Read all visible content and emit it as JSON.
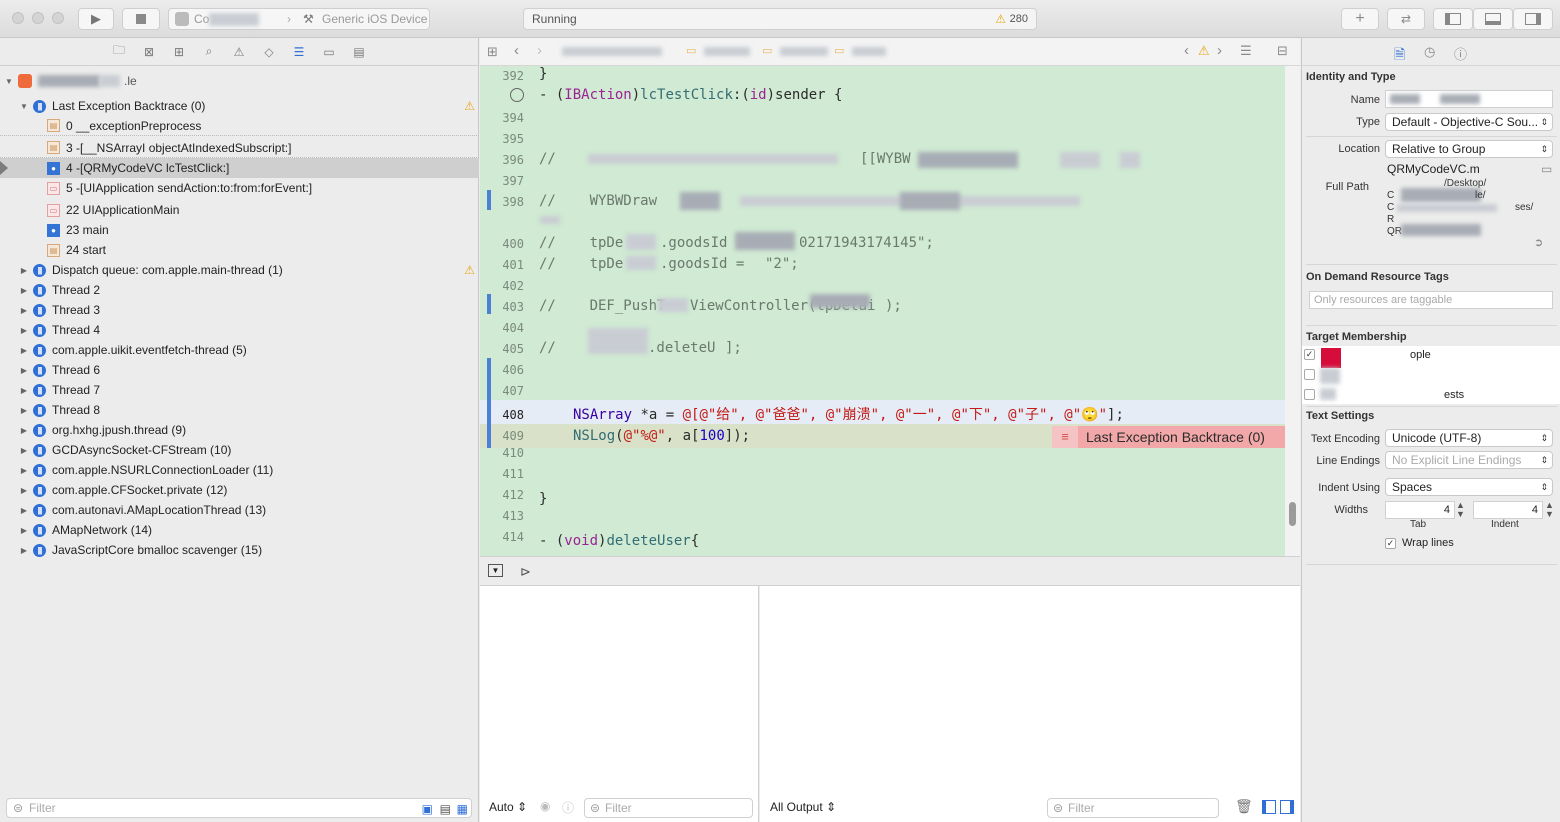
{
  "toolbar": {
    "scheme_prefix": "Co",
    "device": "Generic iOS Device",
    "status": "Running",
    "warning_count": "280"
  },
  "navigator": {
    "rows": [
      {
        "label": "Last Exception Backtrace (0)",
        "warn": true
      },
      {
        "label": "0 __exceptionPreprocess"
      },
      {
        "label": "3 -[__NSArrayI objectAtIndexedSubscript:]"
      },
      {
        "label": "4 -[QRMyCodeVC lcTestClick:]"
      },
      {
        "label": "5 -[UIApplication sendAction:to:from:forEvent:]"
      },
      {
        "label": "22 UIApplicationMain"
      },
      {
        "label": "23 main"
      },
      {
        "label": "24 start"
      },
      {
        "label": "Dispatch queue: com.apple.main-thread (1)",
        "warn": true
      },
      {
        "label": "Thread 2"
      },
      {
        "label": "Thread 3"
      },
      {
        "label": "Thread 4"
      },
      {
        "label": "com.apple.uikit.eventfetch-thread (5)"
      },
      {
        "label": "Thread 6"
      },
      {
        "label": "Thread 7"
      },
      {
        "label": "Thread 8"
      },
      {
        "label": "org.hxhg.jpush.thread (9)"
      },
      {
        "label": "GCDAsyncSocket-CFStream (10)"
      },
      {
        "label": "com.apple.NSURLConnectionLoader (11)"
      },
      {
        "label": "com.apple.CFSocket.private (12)"
      },
      {
        "label": "com.autonavi.AMapLocationThread (13)"
      },
      {
        "label": "AMapNetwork (14)"
      },
      {
        "label": "JavaScriptCore bmalloc scavenger (15)"
      }
    ],
    "project_suffix": ".le",
    "filter_placeholder": "Filter"
  },
  "editor": {
    "line_numbers": [
      "392",
      "",
      "394",
      "395",
      "396",
      "397",
      "398",
      "",
      "400",
      "401",
      "402",
      "403",
      "404",
      "405",
      "406",
      "407",
      "408",
      "409",
      "410",
      "411",
      "412",
      "413",
      "414"
    ],
    "code": {
      "l392": "}",
      "l393_a": "- (",
      "l393_b": "IBAction",
      "l393_c": ")",
      "l393_d": "lcTestClick",
      "l393_e": ":(",
      "l393_f": "id",
      "l393_g": ")sender {",
      "l396": "//    ",
      "l396_tail": "[[WYBW",
      "l398": "//    WYBWDraw",
      "l400": "//    ",
      "l400_a": "tpDe",
      "l400_b": ".goodsId",
      "l400_c": "02171943174145\";",
      "l401": "//    ",
      "l401_a": "tpDe",
      "l401_b": ".goodsId = ",
      "l401_c": "\"2\";",
      "l403": "//    DEF_PushT",
      "l403_b": "ViewController(tpDetai",
      "l403_c": ");",
      "l405": "//    ",
      "l405_b": ".deleteU",
      "l405_c": "];",
      "l408_a": "NSArray",
      "l408_b": " *a = ",
      "l408_c": "@[@\"给\", @\"爸爸\", @\"崩溃\", @\"一\", @\"下\", @\"子\", @\"",
      "l408_d": "🙄",
      "l408_e": "\"",
      "l408_f": "];",
      "l409_a": "NSLog",
      "l409_b": "(",
      "l409_c": "@\"%@\"",
      "l409_d": ", a[",
      "l409_e": "100",
      "l409_f": "]);",
      "l412": "}",
      "l414_a": "- (",
      "l414_b": "void",
      "l414_c": ")",
      "l414_d": "deleteUser",
      "l414_e": "{"
    },
    "error_label": "Last Exception Backtrace (0)"
  },
  "debug": {
    "auto_label": "Auto",
    "filter_placeholder": "Filter",
    "all_output_label": "All Output",
    "console_filter_placeholder": "Filter"
  },
  "inspector": {
    "identity_header": "Identity and Type",
    "name_label": "Name",
    "type_label": "Type",
    "type_value": "Default - Objective-C Sou...",
    "location_label": "Location",
    "location_value": "Relative to Group",
    "file_name": "QRMyCodeVC.m",
    "full_path_label": "Full Path",
    "path_line1": "/Desktop/",
    "path_line2": "C",
    "path_line2b": "le/",
    "path_line3": "C",
    "path_line3b": "ses/",
    "path_line4": "R",
    "path_line5": "QR",
    "odr_header": "On Demand Resource Tags",
    "odr_placeholder": "Only resources are taggable",
    "target_header": "Target Membership",
    "target1": "ople",
    "target3": "ests",
    "text_header": "Text Settings",
    "encoding_label": "Text Encoding",
    "encoding_value": "Unicode (UTF-8)",
    "line_endings_label": "Line Endings",
    "line_endings_value": "No Explicit Line Endings",
    "indent_using_label": "Indent Using",
    "indent_using_value": "Spaces",
    "widths_label": "Widths",
    "tab_value": "4",
    "indent_value": "4",
    "tab_caption": "Tab",
    "indent_caption": "Indent",
    "wrap_label": "Wrap lines"
  }
}
